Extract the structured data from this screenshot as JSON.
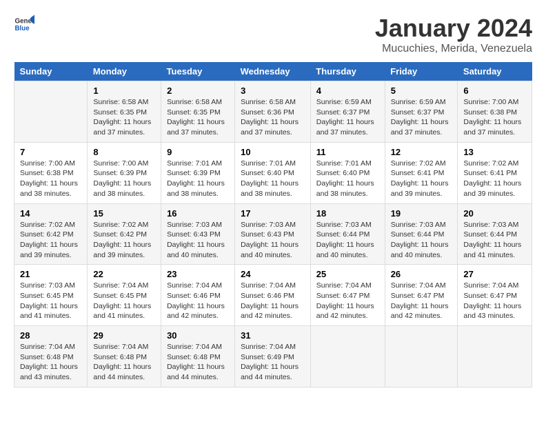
{
  "header": {
    "logo_general": "General",
    "logo_blue": "Blue",
    "title": "January 2024",
    "subtitle": "Mucuchies, Merida, Venezuela"
  },
  "calendar": {
    "days_of_week": [
      "Sunday",
      "Monday",
      "Tuesday",
      "Wednesday",
      "Thursday",
      "Friday",
      "Saturday"
    ],
    "weeks": [
      [
        {
          "day": "",
          "info": ""
        },
        {
          "day": "1",
          "info": "Sunrise: 6:58 AM\nSunset: 6:35 PM\nDaylight: 11 hours\nand 37 minutes."
        },
        {
          "day": "2",
          "info": "Sunrise: 6:58 AM\nSunset: 6:35 PM\nDaylight: 11 hours\nand 37 minutes."
        },
        {
          "day": "3",
          "info": "Sunrise: 6:58 AM\nSunset: 6:36 PM\nDaylight: 11 hours\nand 37 minutes."
        },
        {
          "day": "4",
          "info": "Sunrise: 6:59 AM\nSunset: 6:37 PM\nDaylight: 11 hours\nand 37 minutes."
        },
        {
          "day": "5",
          "info": "Sunrise: 6:59 AM\nSunset: 6:37 PM\nDaylight: 11 hours\nand 37 minutes."
        },
        {
          "day": "6",
          "info": "Sunrise: 7:00 AM\nSunset: 6:38 PM\nDaylight: 11 hours\nand 37 minutes."
        }
      ],
      [
        {
          "day": "7",
          "info": "Sunrise: 7:00 AM\nSunset: 6:38 PM\nDaylight: 11 hours\nand 38 minutes."
        },
        {
          "day": "8",
          "info": "Sunrise: 7:00 AM\nSunset: 6:39 PM\nDaylight: 11 hours\nand 38 minutes."
        },
        {
          "day": "9",
          "info": "Sunrise: 7:01 AM\nSunset: 6:39 PM\nDaylight: 11 hours\nand 38 minutes."
        },
        {
          "day": "10",
          "info": "Sunrise: 7:01 AM\nSunset: 6:40 PM\nDaylight: 11 hours\nand 38 minutes."
        },
        {
          "day": "11",
          "info": "Sunrise: 7:01 AM\nSunset: 6:40 PM\nDaylight: 11 hours\nand 38 minutes."
        },
        {
          "day": "12",
          "info": "Sunrise: 7:02 AM\nSunset: 6:41 PM\nDaylight: 11 hours\nand 39 minutes."
        },
        {
          "day": "13",
          "info": "Sunrise: 7:02 AM\nSunset: 6:41 PM\nDaylight: 11 hours\nand 39 minutes."
        }
      ],
      [
        {
          "day": "14",
          "info": "Sunrise: 7:02 AM\nSunset: 6:42 PM\nDaylight: 11 hours\nand 39 minutes."
        },
        {
          "day": "15",
          "info": "Sunrise: 7:02 AM\nSunset: 6:42 PM\nDaylight: 11 hours\nand 39 minutes."
        },
        {
          "day": "16",
          "info": "Sunrise: 7:03 AM\nSunset: 6:43 PM\nDaylight: 11 hours\nand 40 minutes."
        },
        {
          "day": "17",
          "info": "Sunrise: 7:03 AM\nSunset: 6:43 PM\nDaylight: 11 hours\nand 40 minutes."
        },
        {
          "day": "18",
          "info": "Sunrise: 7:03 AM\nSunset: 6:44 PM\nDaylight: 11 hours\nand 40 minutes."
        },
        {
          "day": "19",
          "info": "Sunrise: 7:03 AM\nSunset: 6:44 PM\nDaylight: 11 hours\nand 40 minutes."
        },
        {
          "day": "20",
          "info": "Sunrise: 7:03 AM\nSunset: 6:44 PM\nDaylight: 11 hours\nand 41 minutes."
        }
      ],
      [
        {
          "day": "21",
          "info": "Sunrise: 7:03 AM\nSunset: 6:45 PM\nDaylight: 11 hours\nand 41 minutes."
        },
        {
          "day": "22",
          "info": "Sunrise: 7:04 AM\nSunset: 6:45 PM\nDaylight: 11 hours\nand 41 minutes."
        },
        {
          "day": "23",
          "info": "Sunrise: 7:04 AM\nSunset: 6:46 PM\nDaylight: 11 hours\nand 42 minutes."
        },
        {
          "day": "24",
          "info": "Sunrise: 7:04 AM\nSunset: 6:46 PM\nDaylight: 11 hours\nand 42 minutes."
        },
        {
          "day": "25",
          "info": "Sunrise: 7:04 AM\nSunset: 6:47 PM\nDaylight: 11 hours\nand 42 minutes."
        },
        {
          "day": "26",
          "info": "Sunrise: 7:04 AM\nSunset: 6:47 PM\nDaylight: 11 hours\nand 42 minutes."
        },
        {
          "day": "27",
          "info": "Sunrise: 7:04 AM\nSunset: 6:47 PM\nDaylight: 11 hours\nand 43 minutes."
        }
      ],
      [
        {
          "day": "28",
          "info": "Sunrise: 7:04 AM\nSunset: 6:48 PM\nDaylight: 11 hours\nand 43 minutes."
        },
        {
          "day": "29",
          "info": "Sunrise: 7:04 AM\nSunset: 6:48 PM\nDaylight: 11 hours\nand 44 minutes."
        },
        {
          "day": "30",
          "info": "Sunrise: 7:04 AM\nSunset: 6:48 PM\nDaylight: 11 hours\nand 44 minutes."
        },
        {
          "day": "31",
          "info": "Sunrise: 7:04 AM\nSunset: 6:49 PM\nDaylight: 11 hours\nand 44 minutes."
        },
        {
          "day": "",
          "info": ""
        },
        {
          "day": "",
          "info": ""
        },
        {
          "day": "",
          "info": ""
        }
      ]
    ]
  }
}
